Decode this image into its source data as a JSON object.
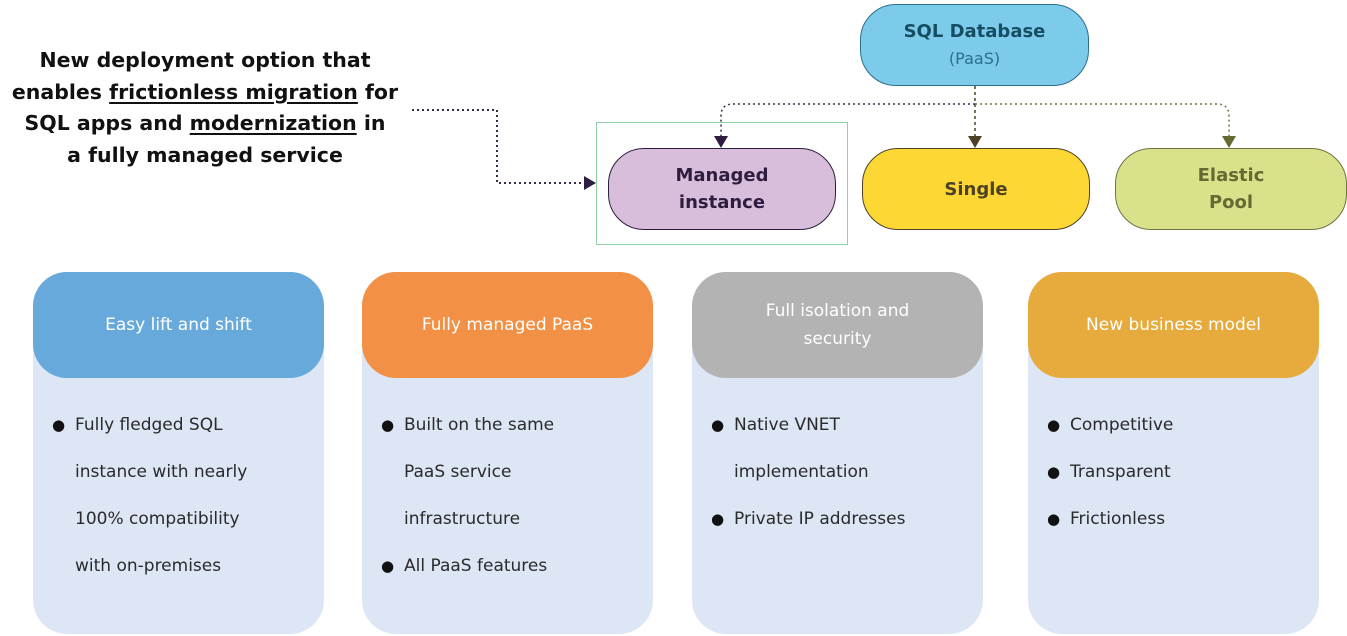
{
  "callout": {
    "line1": "New deployment option that",
    "line2_pre": "enables ",
    "line2_u": "frictionless migration",
    "line2_post": " for",
    "line3_pre": "SQL apps and ",
    "line3_u": "modernization",
    "line3_post": " in",
    "line4": "a fully managed service"
  },
  "hierarchy": {
    "root": {
      "title": "SQL Database",
      "subtitle": "(PaaS)",
      "color": "#7dcbea"
    },
    "children": [
      {
        "id": "managed-instance",
        "line1": "Managed",
        "line2": "instance",
        "color": "#d9bedb",
        "highlighted": true
      },
      {
        "id": "single",
        "line1": "Single",
        "line2": "",
        "color": "#fdd835",
        "highlighted": false
      },
      {
        "id": "elastic-pool",
        "line1": "Elastic",
        "line2": "Pool",
        "color": "#d9e28b",
        "highlighted": false
      }
    ]
  },
  "cards": [
    {
      "title": "Easy lift and shift",
      "color": "#68a9dc",
      "bullets": [
        "Fully fledged SQL instance with nearly 100% compatibility with on-premises"
      ],
      "lines": [
        [
          "• ",
          "Fully fledged SQL"
        ],
        [
          "",
          "instance with nearly"
        ],
        [
          "",
          "100% compatibility"
        ],
        [
          "",
          "with on-premises"
        ]
      ]
    },
    {
      "title": "Fully managed PaaS",
      "color": "#f29146",
      "bullets": [
        "Built on the same PaaS service infrastructure",
        "All PaaS features"
      ],
      "lines": [
        [
          "• ",
          "Built on the same"
        ],
        [
          "",
          "PaaS service"
        ],
        [
          "",
          "infrastructure"
        ],
        [
          "• ",
          "All PaaS features"
        ]
      ]
    },
    {
      "title": "Full isolation and security",
      "color": "#b3b3b3",
      "bullets": [
        "Native VNET implementation",
        "Private IP addresses"
      ],
      "lines": [
        [
          "• ",
          "Native VNET"
        ],
        [
          "",
          "implementation"
        ],
        [
          "• ",
          "Private IP addresses"
        ]
      ]
    },
    {
      "title": "New business model",
      "color": "#e6ab3c",
      "bullets": [
        "Competitive",
        "Transparent",
        "Frictionless"
      ],
      "lines": [
        [
          "• ",
          "Competitive"
        ],
        [
          "• ",
          "Transparent"
        ],
        [
          "• ",
          "Frictionless"
        ]
      ]
    }
  ]
}
